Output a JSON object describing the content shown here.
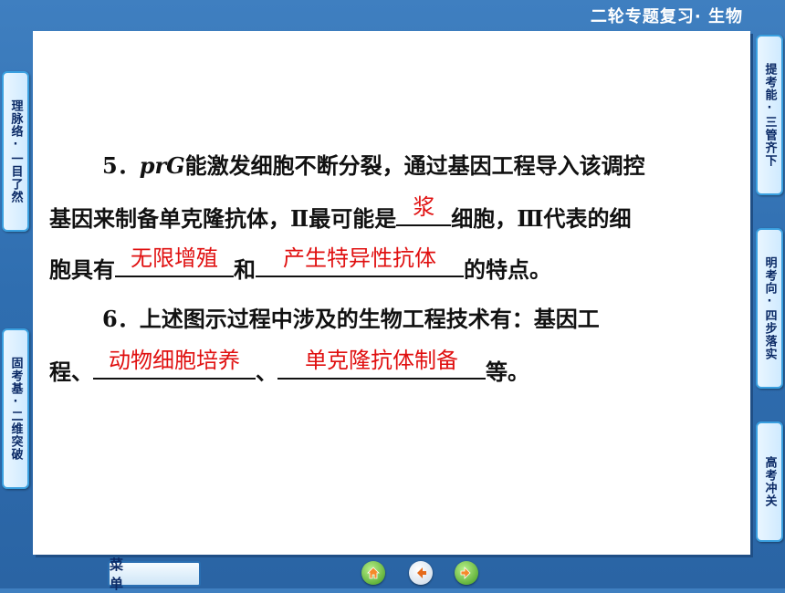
{
  "header": {
    "title": "二轮专题复习· 生物"
  },
  "left_tabs": [
    {
      "label": "理脉络·一目了然"
    },
    {
      "label": "固考基·二维突破"
    }
  ],
  "right_tabs": [
    {
      "label": "提考能·三管齐下"
    },
    {
      "label": "明考向·四步落实"
    },
    {
      "label": "高考冲关"
    }
  ],
  "question5": {
    "number": "5．",
    "term": "prG",
    "line1": "能激发细胞不断分裂，通过基因工程导入该调控",
    "line2_pre": "基因来制备单克隆抗体，Ⅱ最可能是",
    "answer1": "浆",
    "line2_post": "细胞，Ⅲ代表的细",
    "line3_pre": "胞具有",
    "answer2": "无限增殖",
    "line3_mid": "和",
    "answer3": "产生特异性抗体",
    "line3_post": "的特点。"
  },
  "question6": {
    "number": "6．",
    "line1": "上述图示过程中涉及的生物工程技术有：基因工",
    "line2_pre": "程、",
    "answer1": "动物细胞培养",
    "line2_mid": "、",
    "answer2": "单克隆抗体制备",
    "line2_post": "等。"
  },
  "footer": {
    "menu_label": "菜 单",
    "nav_icons": [
      "home-icon",
      "back-icon",
      "forward-icon"
    ]
  },
  "colors": {
    "background": "#2f6eb0",
    "answer": "#e01010",
    "tab_border": "#3aa0e0"
  }
}
